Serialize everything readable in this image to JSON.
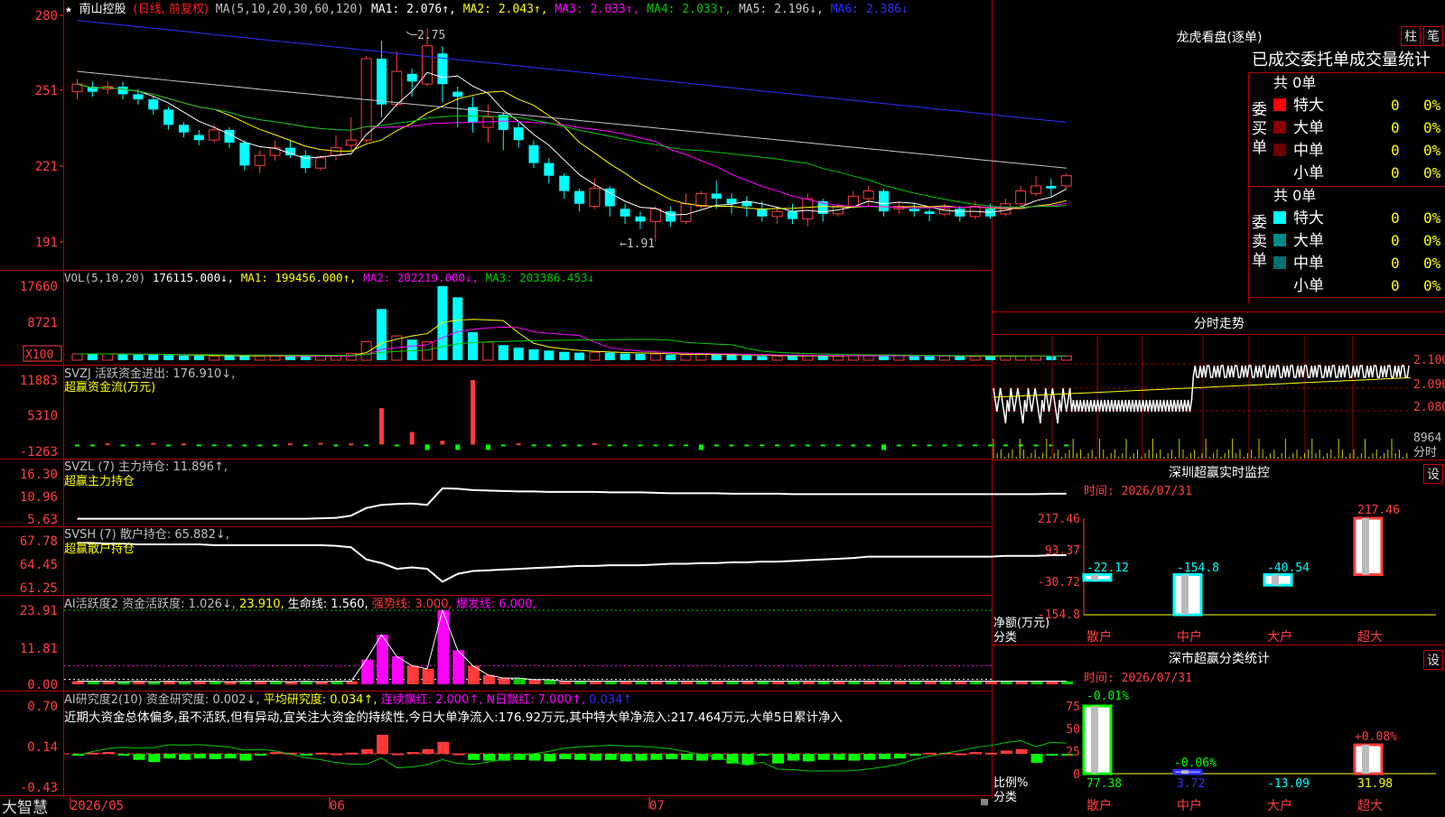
{
  "colors": {
    "up": "#ff3b3b",
    "down": "#00ffff",
    "grid": "#9b0000",
    "axis": "#ff4040",
    "ma1": "#ffffff",
    "ma2": "#ffff00",
    "ma3": "#ff00ff",
    "ma4": "#00cc00",
    "ma5": "#c8c8c8",
    "ma6": "#3030ff"
  },
  "header": {
    "star": "★",
    "stock_name": "南山控股",
    "adj": "(日线, 前复权)",
    "ma_params": "MA(5,10,20,30,60,120)",
    "ma1": "MA1: 2.076↑,",
    "ma2": "MA2: 2.043↑,",
    "ma3": "MA3: 2.033↑,",
    "ma4": "MA4: 2.033↑,",
    "ma5": "MA5: 2.196↓,",
    "ma6": "MA6: 2.386↓"
  },
  "main_chart": {
    "y_ticks": [
      "280",
      "251",
      "221",
      "191"
    ],
    "y_values": [
      2.8,
      2.51,
      2.21,
      1.91
    ],
    "high_label": "2.75",
    "low_label": "←1.91",
    "arrow_high": "←"
  },
  "vol_panel": {
    "title": "VOL(5,10,20)",
    "value": "176115.000↓,",
    "ma1": "MA1: 199456.000↑,",
    "ma2": "MA2: 202219.000↓,",
    "ma3": "MA3: 203386.453↓",
    "y_ticks": [
      "17660",
      "8721",
      "X100"
    ]
  },
  "svzj_panel": {
    "title": "SVZJ  活跃资金进出: 176.910↓,",
    "subtitle": "超赢资金流(万元)",
    "y_ticks": [
      "11883",
      "5310",
      "-1263"
    ]
  },
  "svzl_panel": {
    "title": "SVZL (7) 主力持仓: 11.896↑,",
    "subtitle": "超赢主力持仓",
    "y_ticks": [
      "16.30",
      "10.96",
      "5.63"
    ]
  },
  "svsh_panel": {
    "title": "SVSH (7) 散户持仓: 65.882↓,",
    "subtitle": "超赢散户持仓",
    "y_ticks": [
      "67.78",
      "64.45",
      "61.25"
    ]
  },
  "ai1_panel": {
    "title": "AI活跃度2 资金活跃度: 1.026↓,",
    "v2": "23.910,",
    "v3": "生命线: 1.560,",
    "v4": "强势线: 3.000,",
    "v5": "爆发线: 6.000,",
    "y_ticks": [
      "23.91",
      "11.81",
      "0.00"
    ]
  },
  "ai2_panel": {
    "title": "AI研究度2(10) 资金研究度: 0.002↓,",
    "v2": "平均研究度: 0.034↑,",
    "v3": "连续飘红: 2.000↑,",
    "v4": "N日飘红: 7.000↑,",
    "v5": "0.034↑",
    "comment": "近期大资金总体偏多,虽不活跃,但有异动,宜关注大资金的持续性,今日大单净流入:176.92万元,其中特大单净流入:217.464万元,大单5日累计净入",
    "y_ticks": [
      "0.70",
      "0.14",
      "-0.43"
    ]
  },
  "date_axis": {
    "labels": [
      "2026/05",
      "06",
      "07"
    ]
  },
  "brand": "大智慧",
  "lhb": {
    "title": "龙虎看盘(逐单)",
    "btn1": "柱",
    "btn2": "笔",
    "header": "已成交委托单成交量统计",
    "buy_side": {
      "label": "委买单",
      "total": "共 0单",
      "rows": [
        {
          "name": "特大",
          "count": "0",
          "pct": "0%",
          "color": "#ff0000"
        },
        {
          "name": "大单",
          "count": "0",
          "pct": "0%",
          "color": "#8b0000"
        },
        {
          "name": "中单",
          "count": "0",
          "pct": "0%",
          "color": "#6b0000"
        },
        {
          "name": "小单",
          "count": "0",
          "pct": "0%",
          "color": ""
        }
      ]
    },
    "sell_side": {
      "label": "委卖单",
      "total": "共 0单",
      "rows": [
        {
          "name": "特大",
          "count": "0",
          "pct": "0%",
          "color": "#00ffff"
        },
        {
          "name": "大单",
          "count": "0",
          "pct": "0%",
          "color": "#008b8b"
        },
        {
          "name": "中单",
          "count": "0",
          "pct": "0%",
          "color": "#007070"
        },
        {
          "name": "小单",
          "count": "0",
          "pct": "0%",
          "color": ""
        }
      ]
    }
  },
  "intraday": {
    "title": "分时走势",
    "y_ticks": [
      "2.100",
      "2.090",
      "2.080"
    ],
    "vol_label": "8964",
    "vol_unit": "分时"
  },
  "monitor": {
    "title": "深圳超赢实时监控",
    "btn": "设",
    "time": "时间: 2026/07/31",
    "y_ticks": [
      "217.46",
      "93.37",
      "-30.72",
      "-154.8"
    ],
    "y_label": "净额(万元)",
    "x_label": "分类",
    "categories": [
      "散户",
      "中户",
      "大户",
      "超大"
    ],
    "values": [
      "-22.12",
      "-154.8",
      "-40.54",
      "217.46"
    ]
  },
  "classify": {
    "title": "深市超赢分类统计",
    "btn": "设",
    "time": "时间: 2026/07/31",
    "y_ticks": [
      "75",
      "50",
      "25",
      "0"
    ],
    "y_label": "比例%",
    "x_label": "分类",
    "categories": [
      "散户",
      "中户",
      "大户",
      "超大"
    ],
    "top_labels": [
      "-0.01%",
      "-0.06%",
      "",
      "+0.08%"
    ],
    "values": [
      "77.38",
      "3.72",
      "-13.09",
      "31.98"
    ]
  },
  "chart_data": [
    {
      "type": "candlestick",
      "title": "南山控股 (日线, 前复权)",
      "y_range": [
        1.91,
        2.8
      ],
      "ma": {
        "MA1": 2.076,
        "MA2": 2.043,
        "MA3": 2.033,
        "MA4": 2.033,
        "MA5": 2.196,
        "MA6": 2.386
      },
      "high": 2.75,
      "low": 1.91,
      "candles": [
        [
          2.5,
          2.53,
          2.47,
          2.55
        ],
        [
          2.52,
          2.5,
          2.48,
          2.54
        ],
        [
          2.51,
          2.52,
          2.49,
          2.54
        ],
        [
          2.52,
          2.49,
          2.47,
          2.54
        ],
        [
          2.49,
          2.47,
          2.45,
          2.51
        ],
        [
          2.47,
          2.43,
          2.41,
          2.48
        ],
        [
          2.43,
          2.37,
          2.35,
          2.44
        ],
        [
          2.37,
          2.34,
          2.32,
          2.38
        ],
        [
          2.33,
          2.31,
          2.29,
          2.35
        ],
        [
          2.31,
          2.35,
          2.3,
          2.37
        ],
        [
          2.35,
          2.3,
          2.28,
          2.36
        ],
        [
          2.3,
          2.21,
          2.19,
          2.31
        ],
        [
          2.21,
          2.25,
          2.18,
          2.27
        ],
        [
          2.25,
          2.28,
          2.23,
          2.31
        ],
        [
          2.28,
          2.25,
          2.24,
          2.31
        ],
        [
          2.25,
          2.2,
          2.18,
          2.27
        ],
        [
          2.2,
          2.24,
          2.19,
          2.25
        ],
        [
          2.25,
          2.28,
          2.23,
          2.33
        ],
        [
          2.29,
          2.31,
          2.27,
          2.4
        ],
        [
          2.31,
          2.63,
          2.3,
          2.64
        ],
        [
          2.63,
          2.45,
          2.4,
          2.7
        ],
        [
          2.45,
          2.58,
          2.44,
          2.66
        ],
        [
          2.57,
          2.54,
          2.48,
          2.59
        ],
        [
          2.53,
          2.68,
          2.52,
          2.75
        ],
        [
          2.65,
          2.53,
          2.46,
          2.68
        ],
        [
          2.5,
          2.48,
          2.36,
          2.52
        ],
        [
          2.44,
          2.38,
          2.34,
          2.48
        ],
        [
          2.36,
          2.4,
          2.3,
          2.45
        ],
        [
          2.41,
          2.35,
          2.27,
          2.42
        ],
        [
          2.36,
          2.31,
          2.28,
          2.38
        ],
        [
          2.29,
          2.22,
          2.2,
          2.31
        ],
        [
          2.22,
          2.17,
          2.14,
          2.24
        ],
        [
          2.17,
          2.11,
          2.08,
          2.18
        ],
        [
          2.11,
          2.06,
          2.03,
          2.12
        ],
        [
          2.05,
          2.12,
          2.04,
          2.16
        ],
        [
          2.12,
          2.05,
          2.01,
          2.13
        ],
        [
          2.04,
          2.01,
          1.98,
          2.06
        ],
        [
          2.01,
          1.99,
          1.96,
          2.03
        ],
        [
          1.99,
          2.04,
          1.91,
          2.05
        ],
        [
          2.03,
          1.99,
          1.97,
          2.05
        ],
        [
          1.99,
          2.06,
          1.98,
          2.1
        ],
        [
          2.05,
          2.1,
          2.04,
          2.11
        ],
        [
          2.1,
          2.08,
          2.04,
          2.15
        ],
        [
          2.08,
          2.06,
          2.02,
          2.1
        ],
        [
          2.07,
          2.05,
          2.01,
          2.09
        ],
        [
          2.04,
          2.01,
          1.99,
          2.07
        ],
        [
          2.01,
          2.03,
          1.98,
          2.05
        ],
        [
          2.03,
          2.0,
          1.98,
          2.06
        ],
        [
          2.0,
          2.08,
          1.97,
          2.1
        ],
        [
          2.07,
          2.02,
          1.99,
          2.08
        ],
        [
          2.02,
          2.05,
          2.01,
          2.06
        ],
        [
          2.05,
          2.09,
          2.04,
          2.11
        ],
        [
          2.08,
          2.11,
          2.05,
          2.13
        ],
        [
          2.11,
          2.03,
          2.01,
          2.12
        ],
        [
          2.04,
          2.05,
          2.02,
          2.07
        ],
        [
          2.04,
          2.03,
          2.01,
          2.06
        ],
        [
          2.03,
          2.02,
          1.99,
          2.04
        ],
        [
          2.02,
          2.04,
          2.01,
          2.06
        ],
        [
          2.04,
          2.01,
          1.99,
          2.05
        ],
        [
          2.01,
          2.05,
          2.0,
          2.07
        ],
        [
          2.04,
          2.01,
          2.0,
          2.06
        ],
        [
          2.02,
          2.06,
          2.01,
          2.08
        ],
        [
          2.06,
          2.11,
          2.05,
          2.13
        ],
        [
          2.1,
          2.13,
          2.09,
          2.17
        ],
        [
          2.13,
          2.12,
          2.09,
          2.16
        ],
        [
          2.13,
          2.17,
          2.12,
          2.18
        ]
      ]
    },
    {
      "type": "bar",
      "title": "VOL(5,10,20)",
      "unit": "X100",
      "y_range": [
        0,
        17660
      ],
      "values": [
        1500,
        1500,
        1500,
        1400,
        1300,
        1300,
        1200,
        1100,
        1100,
        1000,
        1000,
        1100,
        1000,
        1000,
        900,
        900,
        1000,
        1100,
        1600,
        4400,
        12200,
        5800,
        4900,
        4400,
        17660,
        15000,
        6700,
        4300,
        3600,
        3000,
        2600,
        2300,
        2000,
        1800,
        1900,
        1800,
        1600,
        1500,
        1500,
        1300,
        1300,
        1400,
        1300,
        1200,
        1100,
        1000,
        1000,
        1000,
        1100,
        1000,
        1000,
        1100,
        1100,
        1200,
        1100,
        1000,
        1000,
        1000,
        900,
        900,
        900,
        1000,
        1000,
        1000,
        1000,
        1000
      ]
    },
    {
      "type": "bar",
      "title": "超赢资金流(万元)",
      "y_range": [
        -1263,
        11883
      ],
      "values": [
        -300,
        -250,
        200,
        -200,
        -250,
        300,
        -250,
        200,
        -250,
        -300,
        -250,
        -300,
        -200,
        -250,
        200,
        -250,
        300,
        -250,
        200,
        -300,
        6700,
        -300,
        2300,
        -1000,
        700,
        -1000,
        11883,
        -1000,
        -300,
        200,
        -250,
        -300,
        -250,
        -300,
        250,
        -250,
        -300,
        -250,
        -300,
        -200,
        -250,
        -1000,
        -200,
        -300,
        -250,
        -300,
        -250,
        -300,
        -200,
        -250,
        -300,
        -250,
        -300,
        -1000,
        -250,
        -300,
        -250,
        -200,
        -300,
        -250,
        -300,
        -250,
        -300,
        -250,
        -300,
        -200
      ]
    },
    {
      "type": "line",
      "title": "超赢主力持仓",
      "y_range": [
        5.63,
        16.3
      ],
      "values": [
        6.3,
        6.3,
        6.3,
        6.3,
        6.3,
        6.3,
        6.3,
        6.3,
        6.3,
        6.3,
        6.3,
        6.3,
        6.3,
        6.3,
        6.3,
        6.3,
        6.4,
        6.5,
        7.0,
        8.7,
        9.4,
        9.6,
        9.7,
        9.4,
        13.1,
        13.0,
        12.7,
        12.6,
        12.5,
        12.4,
        12.4,
        12.3,
        12.3,
        12.3,
        12.3,
        12.2,
        12.2,
        12.2,
        12.1,
        12.0,
        12.0,
        12.0,
        12.0,
        11.9,
        11.9,
        11.9,
        11.9,
        11.8,
        11.8,
        11.8,
        11.8,
        11.8,
        11.8,
        11.8,
        11.8,
        11.8,
        11.8,
        11.8,
        11.8,
        11.8,
        11.8,
        11.8,
        11.8,
        11.8,
        11.9,
        11.9
      ]
    },
    {
      "type": "line",
      "title": "超赢散户持仓",
      "y_range": [
        61.25,
        67.78
      ],
      "values": [
        67.6,
        67.6,
        67.5,
        67.5,
        67.4,
        67.4,
        67.4,
        67.4,
        67.4,
        67.3,
        67.3,
        67.3,
        67.3,
        67.3,
        67.3,
        67.3,
        67.3,
        67.2,
        67.0,
        65.3,
        64.8,
        64.0,
        64.2,
        64.0,
        62.2,
        63.3,
        63.7,
        63.8,
        63.9,
        64.0,
        64.1,
        64.2,
        64.3,
        64.4,
        64.4,
        64.5,
        64.5,
        64.5,
        64.6,
        64.7,
        64.7,
        64.8,
        64.8,
        64.9,
        64.9,
        65.0,
        65.0,
        65.1,
        65.2,
        65.3,
        65.4,
        65.5,
        65.7,
        65.7,
        65.7,
        65.7,
        65.7,
        65.7,
        65.7,
        65.7,
        65.7,
        65.8,
        65.8,
        65.8,
        65.9,
        65.9
      ]
    },
    {
      "type": "bar",
      "title": "AI活跃度2",
      "y_range": [
        0,
        23.91
      ],
      "values": [
        1.0,
        1.0,
        1.0,
        0.8,
        1.0,
        0.8,
        1.0,
        0.8,
        1.0,
        1.0,
        0.8,
        1.0,
        1.0,
        1.0,
        0.8,
        1.0,
        0.8,
        1.0,
        1.0,
        8.0,
        16.0,
        9.0,
        6.0,
        5.0,
        23.91,
        11.0,
        6.0,
        3.0,
        2.0,
        2.0,
        1.5,
        1.5,
        1.0,
        1.0,
        1.0,
        1.0,
        1.0,
        1.0,
        1.0,
        1.0,
        1.0,
        1.0,
        1.0,
        1.0,
        1.0,
        1.0,
        1.0,
        1.0,
        1.0,
        1.0,
        1.0,
        1.0,
        1.0,
        1.0,
        1.0,
        1.0,
        1.0,
        1.0,
        1.0,
        1.0,
        1.0,
        1.0,
        1.0,
        1.0,
        1.0,
        1.0
      ]
    },
    {
      "type": "bar",
      "title": "AI研究度2(10)",
      "y_range": [
        -0.43,
        0.7
      ],
      "values": [
        0.03,
        0.05,
        0.06,
        0.03,
        -0.05,
        -0.08,
        -0.03,
        -0.05,
        -0.03,
        -0.04,
        -0.03,
        -0.06,
        0.03,
        0.06,
        0.05,
        0.03,
        0.05,
        0.04,
        0.05,
        0.1,
        0.3,
        0.04,
        0.06,
        0.1,
        0.2,
        0.04,
        -0.05,
        -0.06,
        -0.06,
        -0.05,
        -0.06,
        -0.07,
        -0.04,
        -0.05,
        -0.06,
        -0.05,
        -0.07,
        -0.06,
        -0.05,
        -0.04,
        -0.05,
        -0.06,
        -0.05,
        -0.1,
        -0.12,
        0.03,
        -0.1,
        -0.06,
        -0.07,
        -0.05,
        -0.05,
        -0.06,
        -0.05,
        -0.04,
        -0.03,
        0.03,
        0.05,
        0.05,
        0.04,
        0.06,
        0.05,
        0.08,
        0.1,
        -0.09,
        0.03,
        0.02
      ]
    },
    {
      "type": "bar",
      "title": "深圳超赢实时监控",
      "categories": [
        "散户",
        "中户",
        "大户",
        "超大"
      ],
      "values": [
        -22.12,
        -154.8,
        -40.54,
        217.46
      ],
      "y_range": [
        -154.8,
        217.46
      ]
    },
    {
      "type": "bar",
      "title": "深市超赢分类统计",
      "categories": [
        "散户",
        "中户",
        "大户",
        "超大"
      ],
      "values": [
        77.38,
        3.72,
        -13.09,
        31.98
      ],
      "y_range": [
        0,
        75
      ]
    }
  ]
}
